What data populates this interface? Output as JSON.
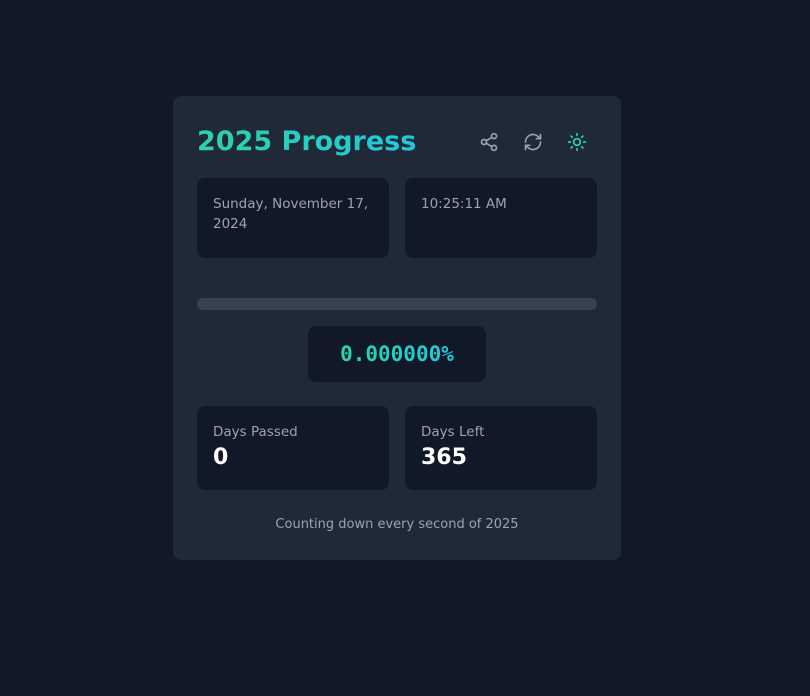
{
  "header": {
    "title": "2025 Progress",
    "icons": [
      "share-icon",
      "refresh-icon",
      "sun-icon"
    ]
  },
  "info": {
    "date": "Sunday, November 17, 2024",
    "time": "10:25:11 AM"
  },
  "progress": {
    "fraction": 0,
    "percent_text": "0.000000%"
  },
  "stats": {
    "days_passed_label": "Days Passed",
    "days_passed_value": "0",
    "days_left_label": "Days Left",
    "days_left_value": "365"
  },
  "footer": {
    "text": "Counting down every second of 2025"
  },
  "colors": {
    "background": "#111827",
    "card": "#1f2937",
    "panel": "#111827",
    "accent_start": "#2dd4a3",
    "accent_end": "#22c7e0",
    "muted_text": "#9ca3af",
    "icon": "#9ca3af",
    "sun_icon": "#2dd4a3",
    "track": "#374151"
  }
}
